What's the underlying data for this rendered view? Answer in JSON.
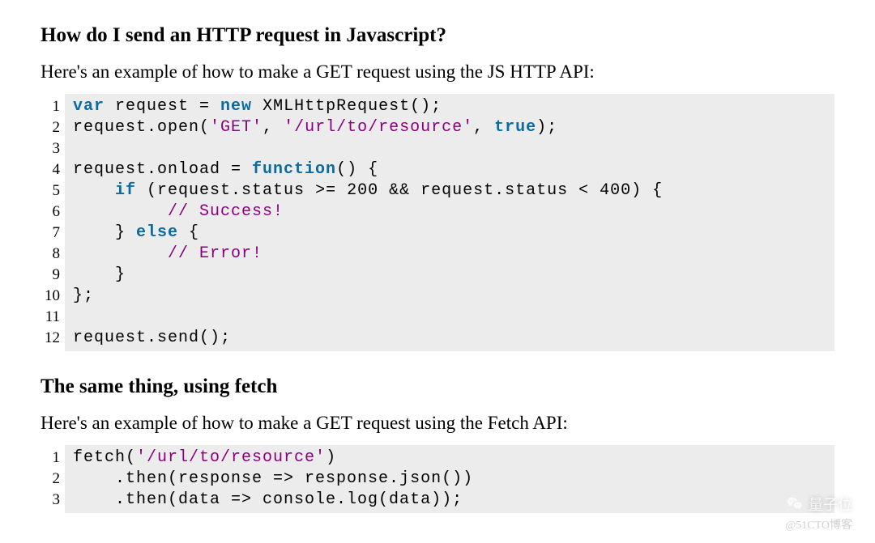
{
  "section1": {
    "heading": "How do I send an HTTP request in Javascript?",
    "intro": "Here's an example of how to make a GET request using the JS HTTP API:"
  },
  "code1": {
    "line_numbers": [
      "1",
      "2",
      "3",
      "4",
      "5",
      "6",
      "7",
      "8",
      "9",
      "10",
      "11",
      "12"
    ],
    "tokens": [
      [
        {
          "t": "var",
          "c": "kw"
        },
        {
          "t": " request = "
        },
        {
          "t": "new",
          "c": "kw"
        },
        {
          "t": " XMLHttpRequest();"
        }
      ],
      [
        {
          "t": "request.open("
        },
        {
          "t": "'GET'",
          "c": "str"
        },
        {
          "t": ", "
        },
        {
          "t": "'/url/to/resource'",
          "c": "str"
        },
        {
          "t": ", "
        },
        {
          "t": "true",
          "c": "kw"
        },
        {
          "t": ");"
        }
      ],
      [
        {
          "t": ""
        }
      ],
      [
        {
          "t": "request.onload = "
        },
        {
          "t": "function",
          "c": "kw"
        },
        {
          "t": "() {"
        }
      ],
      [
        {
          "t": "    "
        },
        {
          "t": "if",
          "c": "kw"
        },
        {
          "t": " (request.status >= 200 && request.status < 400) {"
        }
      ],
      [
        {
          "t": "         "
        },
        {
          "t": "// Success!",
          "c": "cmt"
        }
      ],
      [
        {
          "t": "    } "
        },
        {
          "t": "else",
          "c": "kw"
        },
        {
          "t": " {"
        }
      ],
      [
        {
          "t": "         "
        },
        {
          "t": "// Error!",
          "c": "cmt"
        }
      ],
      [
        {
          "t": "    }"
        }
      ],
      [
        {
          "t": "};"
        }
      ],
      [
        {
          "t": ""
        }
      ],
      [
        {
          "t": "request.send();"
        }
      ]
    ]
  },
  "section2": {
    "heading": "The same thing, using fetch",
    "intro": "Here's an example of how to make a GET request using the Fetch API:"
  },
  "code2": {
    "line_numbers": [
      "1",
      "2",
      "3"
    ],
    "tokens": [
      [
        {
          "t": "fetch("
        },
        {
          "t": "'/url/to/resource'",
          "c": "str"
        },
        {
          "t": ")"
        }
      ],
      [
        {
          "t": "    .then(response => response.json())"
        }
      ],
      [
        {
          "t": "    .then(data => console.log(data));"
        }
      ]
    ]
  },
  "watermark": {
    "main": "量子位",
    "sub": "@51CTO博客"
  }
}
